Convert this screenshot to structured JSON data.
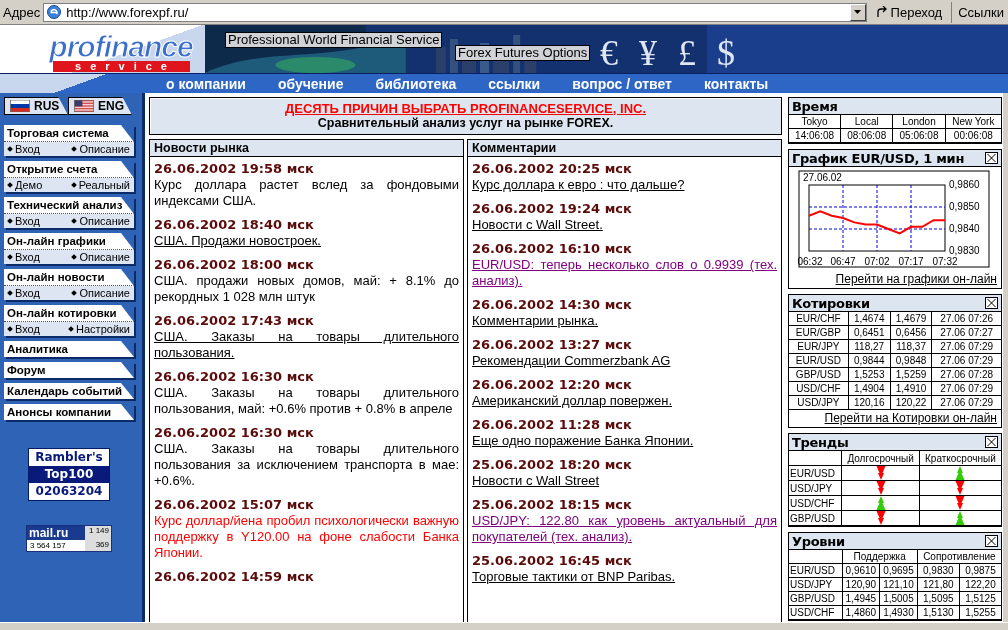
{
  "address_bar": {
    "label": "Адрес",
    "url": "http://www.forexpf.ru/",
    "go_button": "Переход",
    "links": "Ссылки"
  },
  "header": {
    "logo_top": "profinance",
    "logo_bottom": "service",
    "banner_titles": [
      "Professional World Financial Service",
      "Forex Futures Options"
    ],
    "currency_symbols": "€ ¥ £ $",
    "nav": [
      "о компании",
      "обучение",
      "библиотека",
      "ссылки",
      "вопрос / ответ",
      "контакты"
    ]
  },
  "languages": [
    {
      "label": "RUS",
      "kind": "ru"
    },
    {
      "label": "ENG",
      "kind": "us"
    }
  ],
  "sidebar": {
    "sections": [
      {
        "title": "Торговая система",
        "links": [
          "Вход",
          "Описание"
        ]
      },
      {
        "title": "Открытие счета",
        "links": [
          "Демо",
          "Реальный"
        ]
      },
      {
        "title": "Технический анализ",
        "links": [
          "Вход",
          "Описание"
        ]
      },
      {
        "title": "Он-лайн графики",
        "links": [
          "Вход",
          "Описание"
        ]
      },
      {
        "title": "Он-лайн новости",
        "links": [
          "Вход",
          "Описание"
        ]
      },
      {
        "title": "Он-лайн котировки",
        "links": [
          "Вход",
          "Настройки"
        ]
      },
      {
        "title": "Аналитика"
      },
      {
        "title": "Форум"
      },
      {
        "title": "Календарь событий"
      },
      {
        "title": "Анонсы компании"
      }
    ]
  },
  "counters": {
    "rambler": [
      "Rambler's",
      "Top100",
      "02063204"
    ],
    "mailru": {
      "logo": "mail.ru",
      "hits": "1 149",
      "total": "3 564 157",
      "today": "369"
    }
  },
  "promo": {
    "link": "ДЕСЯТЬ ПРИЧИН ВЫБРАТЬ PROFINANCESERVICE, INC.",
    "subtitle": "Сравнительный анализ услуг на рынке FOREX."
  },
  "news": {
    "title": "Новости рынка",
    "items": [
      {
        "date": "26.06.2002 19:58 мск",
        "text": "Курс доллара растет вслед за фондовыми индексами США.",
        "kind": "text"
      },
      {
        "date": "26.06.2002 18:40 мск",
        "text": "США. Продажи новостроек.",
        "kind": "link"
      },
      {
        "date": "26.06.2002 18:00 мск",
        "text": "США. продажи новых домов, май: + 8.1% до рекордных 1 028 млн штук",
        "kind": "text"
      },
      {
        "date": "26.06.2002 17:43 мск",
        "text": "США. Заказы на товары длительного пользования.",
        "kind": "link"
      },
      {
        "date": "26.06.2002 16:30 мск",
        "text": "США. Заказы на товары длительного пользования, май: +0.6% против + 0.8% в апреле",
        "kind": "text"
      },
      {
        "date": "26.06.2002 16:30 мск",
        "text": "США. Заказы на товары длительного пользования за исключением транспорта в мае: +0.6%.",
        "kind": "text"
      },
      {
        "date": "26.06.2002 15:07 мск",
        "text": "Курс доллар/йена пробил психологически важную поддержку в Y120.00 на фоне слабости Банка Японии.",
        "kind": "alert"
      },
      {
        "date": "26.06.2002 14:59 мск"
      }
    ]
  },
  "comments": {
    "title": "Комментарии",
    "items": [
      {
        "date": "26.06.2002 20:25 мск",
        "text": "Курс доллара к евро : что дальше?",
        "kind": "link"
      },
      {
        "date": "26.06.2002 19:24 мск",
        "text": "Новости с Wall Street.",
        "kind": "link"
      },
      {
        "date": "26.06.2002 16:10 мск",
        "text": "EUR/USD: теперь несколько слов о 0.9939 (тех. анализ).",
        "kind": "visited"
      },
      {
        "date": "26.06.2002 14:30 мск",
        "text": "Комментарии рынка.",
        "kind": "link"
      },
      {
        "date": "26.06.2002 13:27 мск",
        "text": "Рекомендации Commerzbank AG",
        "kind": "link"
      },
      {
        "date": "26.06.2002 12:20 мск",
        "text": "Американский доллар повержен.",
        "kind": "link"
      },
      {
        "date": "26.06.2002 11:28 мск",
        "text": "Еще одно поражение Банка Японии.",
        "kind": "link"
      },
      {
        "date": "25.06.2002 18:20 мск",
        "text": "Новости с Wall Street",
        "kind": "link"
      },
      {
        "date": "25.06.2002 18:15 мск",
        "text": "USD/JPY: 122.80 как уровень актуальный для покупателей (тех. анализ).",
        "kind": "visited"
      },
      {
        "date": "25.06.2002 16:45 мск",
        "text": "Торговые тактики от BNP Paribas.",
        "kind": "link"
      }
    ]
  },
  "time": {
    "title": "Время",
    "columns": [
      "Tokyo",
      "Local",
      "London",
      "New York"
    ],
    "values": [
      "14:06:08",
      "08:06:08",
      "05:06:08",
      "00:06:08"
    ]
  },
  "chart_panel": {
    "title": "График EUR/USD, 1 мин",
    "link": "Перейти на графики он-лайн",
    "chart_data": {
      "type": "line",
      "title": "27.06.02",
      "categories": [
        "06:32",
        null,
        null,
        "06:47",
        null,
        null,
        "07:02",
        null,
        null,
        "07:17",
        null,
        null,
        "07:32"
      ],
      "series": [
        {
          "color": "#ff0000",
          "values": [
            0.9846,
            0.9848,
            0.9846,
            0.9845,
            0.9843,
            0.9842,
            0.9842,
            0.984,
            0.9838,
            0.9841,
            0.9841,
            0.9844,
            0.9844
          ]
        }
      ],
      "ylim": [
        0.983,
        0.986
      ],
      "grid": true,
      "yticks": [
        {
          "value": 0.983,
          "label": "0,9830"
        },
        {
          "value": 0.984,
          "label": "0,9840"
        },
        {
          "value": 0.985,
          "label": "0,9850"
        },
        {
          "value": 0.986,
          "label": "0,9860"
        }
      ]
    }
  },
  "quotes": {
    "title": "Котировки",
    "rows": [
      [
        "EUR/CHF",
        "1,4674",
        "1,4679",
        "27.06 07:26"
      ],
      [
        "EUR/GBP",
        "0,6451",
        "0,6456",
        "27.06 07:27"
      ],
      [
        "EUR/JPY",
        "118,27",
        "118,37",
        "27.06 07:29"
      ],
      [
        "EUR/USD",
        "0,9844",
        "0,9848",
        "27.06 07:29"
      ],
      [
        "GBP/USD",
        "1,5253",
        "1,5259",
        "27.06 07:28"
      ],
      [
        "USD/CHF",
        "1,4904",
        "1,4910",
        "27.06 07:29"
      ],
      [
        "USD/JPY",
        "120,16",
        "120,22",
        "27.06 07:29"
      ]
    ],
    "link": "Перейти на Котировки он-лайн"
  },
  "trends": {
    "title": "Тренды",
    "columns": [
      "Долгосрочный",
      "Краткосрочный"
    ],
    "rows": [
      {
        "pair": "EUR/USD",
        "long_rising": false,
        "short_rising": true
      },
      {
        "pair": "USD/JPY",
        "long_rising": false,
        "short_rising": false
      },
      {
        "pair": "USD/CHF",
        "long_rising": true,
        "short_rising": false
      },
      {
        "pair": "GBP/USD",
        "long_rising": false,
        "short_rising": true
      }
    ]
  },
  "levels": {
    "title": "Уровни",
    "groups": [
      "Поддержка",
      "Сопротивление"
    ],
    "rows": [
      [
        "EUR/USD",
        "0,9610",
        "0,9695",
        "0,9830",
        "0,9875"
      ],
      [
        "USD/JPY",
        "120,90",
        "121,10",
        "121,80",
        "122,20"
      ],
      [
        "GBP/USD",
        "1,4945",
        "1,5005",
        "1,5095",
        "1,5125"
      ],
      [
        "USD/CHF",
        "1,4860",
        "1,4930",
        "1,5130",
        "1,5255"
      ]
    ]
  }
}
